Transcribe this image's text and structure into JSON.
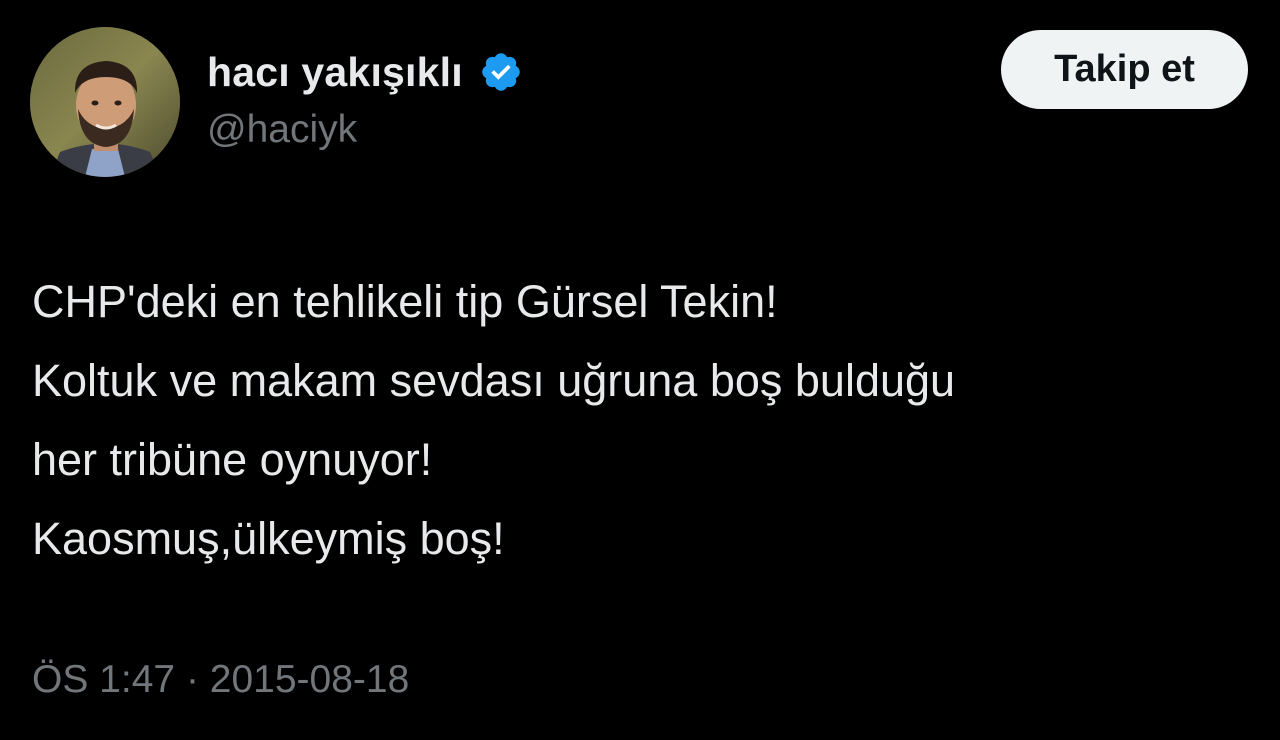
{
  "author": {
    "display_name": "hacı yakışıklı",
    "handle": "@haciyk",
    "verified": true,
    "avatar_icon": "profile-photo"
  },
  "follow_button": {
    "label": "Takip et"
  },
  "tweet": {
    "lines": [
      "CHP'deki en tehlikeli tip Gürsel Tekin!",
      "Koltuk ve makam sevdası uğruna boş bulduğu",
      "her tribüne oynuyor!",
      "Kaosmuş,ülkeymiş boş!"
    ]
  },
  "meta": {
    "time": "ÖS 1:47",
    "separator": "·",
    "date": "2015-08-18"
  },
  "colors": {
    "background": "#000000",
    "text_primary": "#e7e9ea",
    "text_secondary": "#71767b",
    "verified_badge": "#1d9bf0",
    "follow_button_bg": "#eff3f4"
  }
}
